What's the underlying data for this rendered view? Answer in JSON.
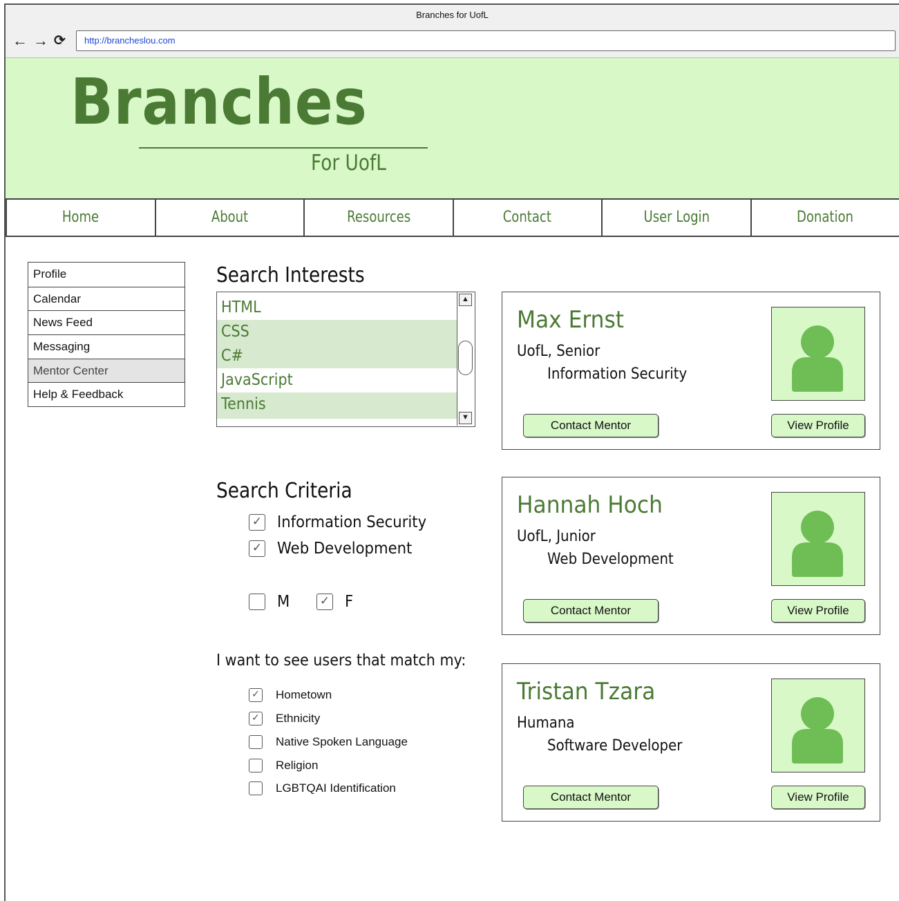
{
  "window": {
    "title": "Branches for UofL"
  },
  "browser": {
    "url": "http://brancheslou.com",
    "back_icon": "←",
    "forward_icon": "→",
    "reload_icon": "⟳"
  },
  "brand": {
    "name": "Branches",
    "subtitle": "For UofL",
    "color": "#4a7a34",
    "banner_color": "#d8f8c8"
  },
  "topnav": [
    "Home",
    "About",
    "Resources",
    "Contact",
    "User Login",
    "Donation"
  ],
  "sidebar": {
    "items": [
      "Profile",
      "Calendar",
      "News Feed",
      "Messaging",
      "Mentor Center",
      "Help & Feedback"
    ],
    "active": "Mentor Center"
  },
  "interests": {
    "title": "Search Interests",
    "options": [
      {
        "label": "HTML",
        "selected": false
      },
      {
        "label": "CSS",
        "selected": true
      },
      {
        "label": "C#",
        "selected": true
      },
      {
        "label": "JavaScript",
        "selected": false
      },
      {
        "label": "Tennis",
        "selected": true
      }
    ],
    "scroll_up": "▲",
    "scroll_down": "▼"
  },
  "criteria": {
    "title": "Search Criteria",
    "fields": [
      {
        "label": "Information Security",
        "checked": true
      },
      {
        "label": "Web Development",
        "checked": true
      }
    ],
    "gender": [
      {
        "label": "M",
        "checked": false
      },
      {
        "label": "F",
        "checked": true
      }
    ]
  },
  "match": {
    "title": "I want to see users that match my:",
    "options": [
      {
        "label": "Hometown",
        "checked": true
      },
      {
        "label": "Ethnicity",
        "checked": true
      },
      {
        "label": "Native Spoken Language",
        "checked": false
      },
      {
        "label": "Religion",
        "checked": false
      },
      {
        "label": "LGBTQAI Identification",
        "checked": false
      }
    ]
  },
  "check_glyph": "✓",
  "mentors": [
    {
      "name": "Max Ernst",
      "org": "UofL, Senior",
      "field": "Information Security",
      "contact_label": "Contact Mentor",
      "view_label": "View Profile"
    },
    {
      "name": "Hannah Hoch",
      "org": "UofL, Junior",
      "field": "Web Development",
      "contact_label": "Contact Mentor",
      "view_label": "View Profile"
    },
    {
      "name": "Tristan Tzara",
      "org": "Humana",
      "field": "Software Developer",
      "contact_label": "Contact Mentor",
      "view_label": "View Profile"
    }
  ],
  "avatar_color": "#6fbd55"
}
